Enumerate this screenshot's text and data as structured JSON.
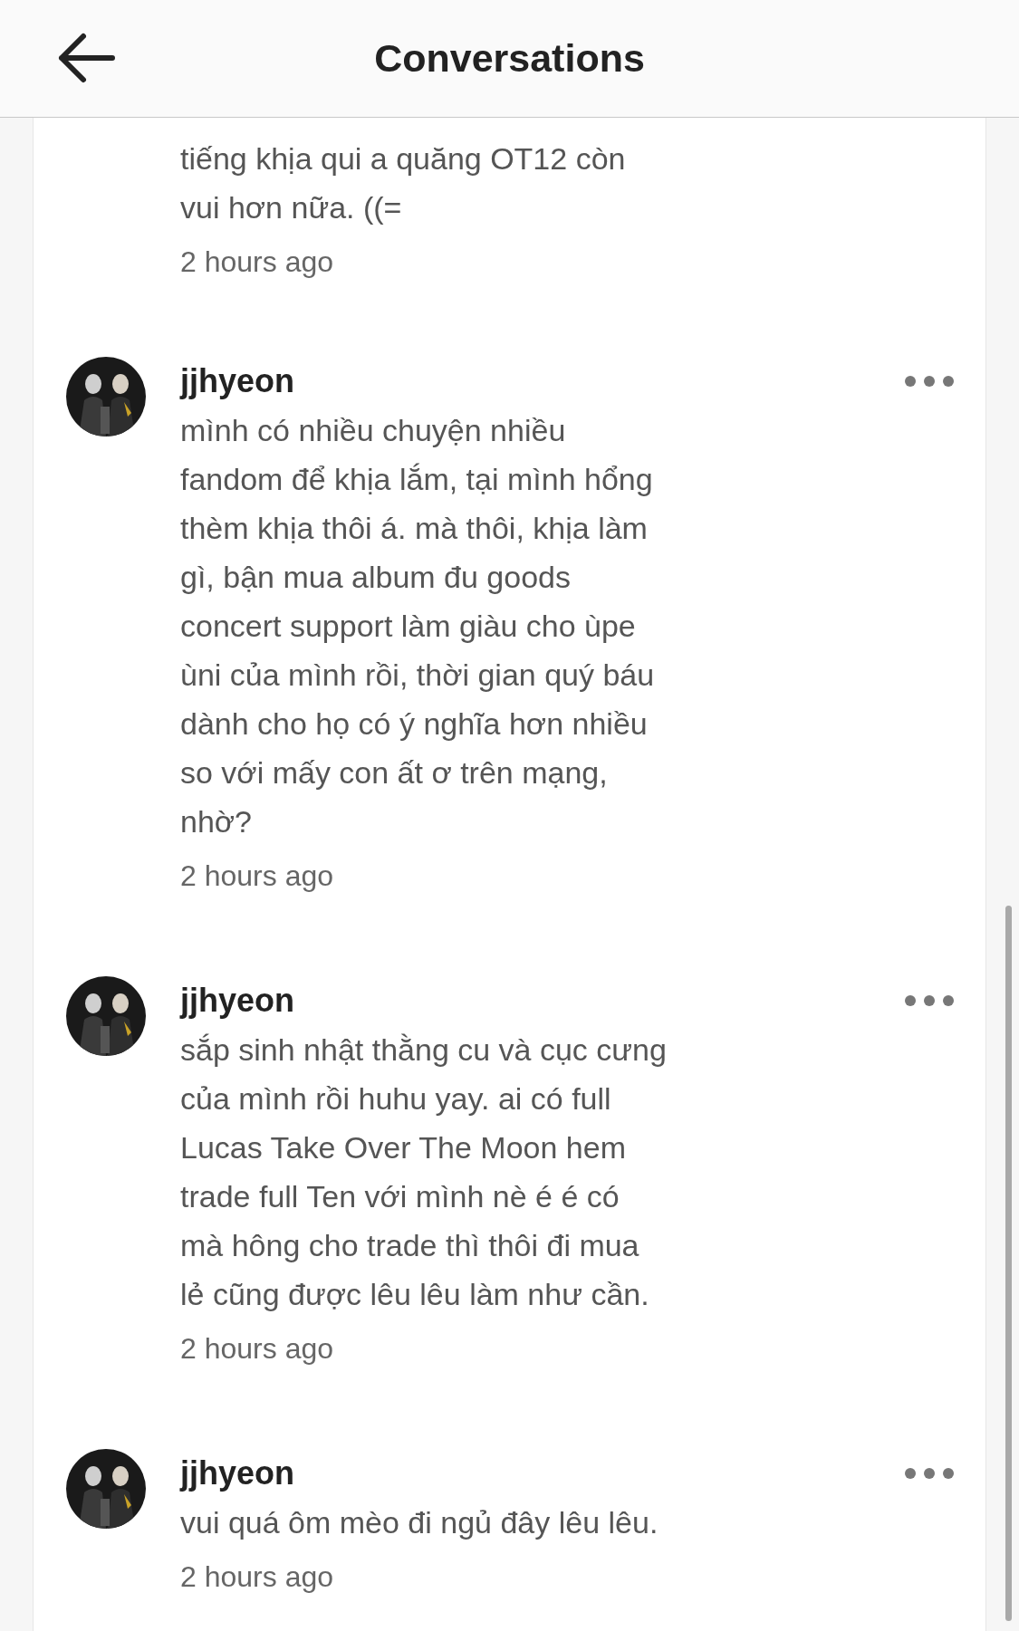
{
  "header": {
    "title": "Conversations"
  },
  "comments": [
    {
      "kind": "partial",
      "lines": [
        "tiếng khịa qui a quăng OT12 còn",
        "vui hơn nữa. ((="
      ],
      "time": "2 hours ago"
    },
    {
      "kind": "full",
      "username": "jjhyeon",
      "lines": [
        "mình có nhiều chuyện nhiều",
        "fandom để khịa lắm, tại mình hổng",
        "thèm khịa thôi á. mà thôi, khịa làm",
        "gì, bận mua album đu goods",
        "concert support làm giàu cho ùpe",
        "ùni của mình rồi, thời gian quý báu",
        "dành cho họ có ý nghĩa hơn nhiều",
        "so với mấy con ất ơ trên mạng,",
        "nhờ?"
      ],
      "time": "2 hours ago"
    },
    {
      "kind": "full",
      "username": "jjhyeon",
      "lines": [
        "sắp sinh nhật thằng cu và cục cưng",
        "của mình rồi huhu yay. ai có full",
        "Lucas Take Over The Moon hem",
        "trade full Ten với mình nè é é có",
        "mà hông cho trade thì thôi đi mua",
        "lẻ cũng được lêu lêu làm như cần."
      ],
      "time": "2 hours ago"
    },
    {
      "kind": "full",
      "username": "jjhyeon",
      "lines": [
        "vui quá ôm mèo đi ngủ đây lêu lêu."
      ],
      "time": "2 hours ago"
    }
  ]
}
